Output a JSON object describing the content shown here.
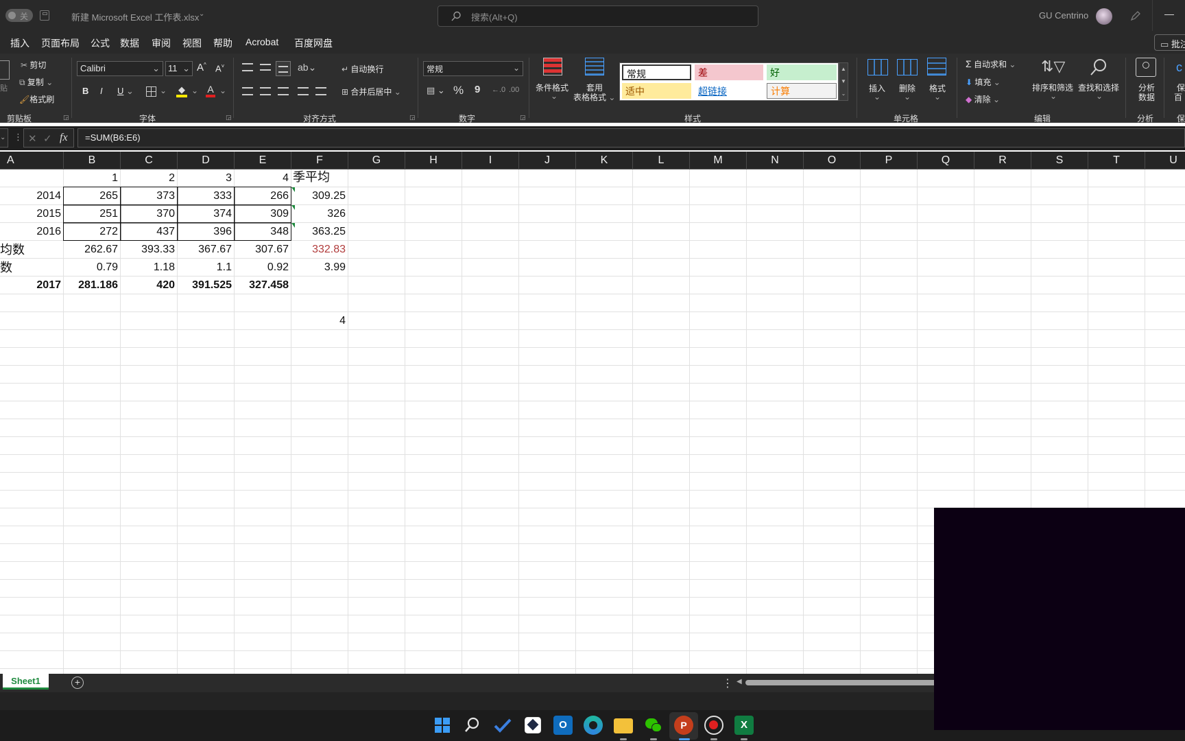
{
  "titlebar": {
    "autosave_label": "关",
    "file_name": "新建 Microsoft Excel 工作表.xlsx",
    "search_placeholder": "搜索(Alt+Q)",
    "user_name": "GU Centrino",
    "minimize": "—"
  },
  "menu": {
    "items": [
      "插入",
      "页面布局",
      "公式",
      "数据",
      "审阅",
      "视图",
      "帮助",
      "Acrobat",
      "百度网盘"
    ],
    "comments_label": "批注"
  },
  "ribbon": {
    "clipboard": {
      "cut": "剪切",
      "copy": "复制",
      "format_painter": "格式刷",
      "group": "剪贴板"
    },
    "font": {
      "name": "Calibri",
      "size": "11",
      "bold": "B",
      "italic": "I",
      "underline": "U",
      "grow": "A",
      "shrink": "A",
      "group": "字体"
    },
    "alignment": {
      "wrap": "自动换行",
      "merge": "合并后居中",
      "group": "对齐方式"
    },
    "number": {
      "format": "常规",
      "percent": "%",
      "comma": "9",
      "group": "数字"
    },
    "styles": {
      "conditional": "条件格式",
      "table_l1": "套用",
      "table_l2": "表格格式",
      "gallery": [
        "常规",
        "差",
        "好",
        "适中",
        "超链接",
        "计算"
      ],
      "group": "样式"
    },
    "cells": {
      "insert": "插入",
      "delete": "删除",
      "format": "格式",
      "group": "单元格"
    },
    "editing": {
      "autosum": "自动求和",
      "fill": "填充",
      "clear": "清除",
      "sort_filter": "排序和筛选",
      "find_select": "查找和选择",
      "group": "编辑"
    },
    "analysis": {
      "analyze_l1": "分析",
      "analyze_l2": "数据",
      "group": "分析"
    },
    "extra": {
      "l1": "保",
      "l2": "百",
      "group": "保"
    }
  },
  "formula_bar": {
    "fx": "fx",
    "formula": "=SUM(B6:E6)"
  },
  "columns": [
    "A",
    "B",
    "C",
    "D",
    "E",
    "F",
    "G",
    "H",
    "I",
    "J",
    "K",
    "L",
    "M",
    "N",
    "O",
    "P",
    "Q",
    "R",
    "S",
    "T",
    "U"
  ],
  "cells": {
    "r1": {
      "b": "1",
      "c": "2",
      "d": "3",
      "e": "4",
      "f": "季平均"
    },
    "r2": {
      "a": "2014",
      "b": "265",
      "c": "373",
      "d": "333",
      "e": "266",
      "f": "309.25"
    },
    "r3": {
      "a": "2015",
      "b": "251",
      "c": "370",
      "d": "374",
      "e": "309",
      "f": "326"
    },
    "r4": {
      "a": "2016",
      "b": "272",
      "c": "437",
      "d": "396",
      "e": "348",
      "f": "363.25"
    },
    "r5": {
      "a": "均数",
      "b": "262.67",
      "c": "393.33",
      "d": "367.67",
      "e": "307.67",
      "f": "332.83"
    },
    "r6": {
      "a": "数",
      "b": "0.79",
      "c": "1.18",
      "d": "1.1",
      "e": "0.92",
      "f": "3.99"
    },
    "r7": {
      "a": "2017",
      "b": "281.186",
      "c": "420",
      "d": "391.525",
      "e": "327.458"
    },
    "r9": {
      "f": "4"
    }
  },
  "sheet": {
    "tab": "Sheet1",
    "add": "+"
  },
  "colors": {
    "accent_green": "#1e8a3e",
    "highlight_red": "#b13c3c",
    "bad_bg": "#f4c7ce",
    "good_bg": "#c6efce",
    "neutral_bg": "#ffeb9c"
  }
}
